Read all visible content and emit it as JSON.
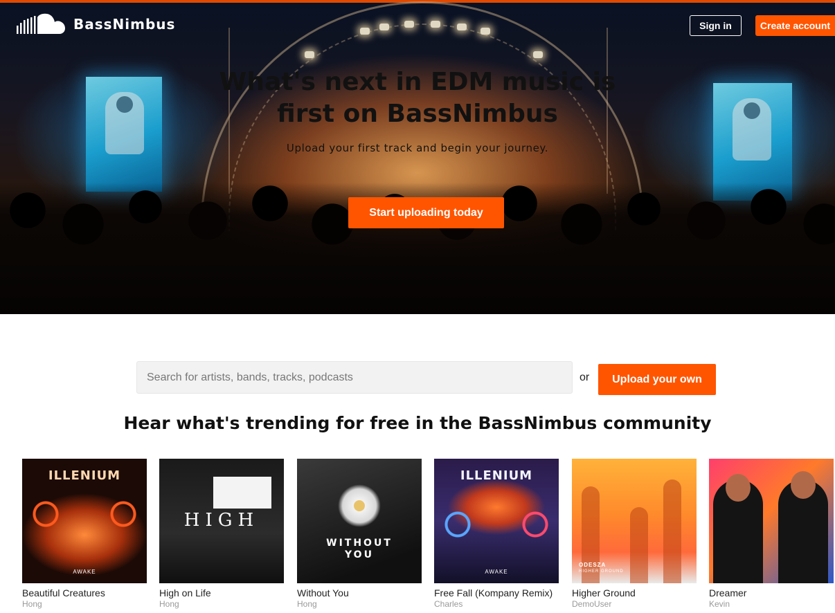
{
  "brand": {
    "name": "BassNimbus"
  },
  "header": {
    "sign_in": "Sign in",
    "create_account": "Create account"
  },
  "hero": {
    "title": "What's next in EDM music is first on BassNimbus",
    "subtitle": "Upload your first track and begin your journey.",
    "cta": "Start uploading today"
  },
  "search": {
    "placeholder": "Search for artists, bands, tracks, podcasts",
    "or_text": "or",
    "upload_button": "Upload your own"
  },
  "trending": {
    "heading": "Hear what's trending for free in the BassNimbus community",
    "tracks": [
      {
        "title": "Beautiful Creatures",
        "artist": "Hong",
        "art_text": "ILLENIUM",
        "art_sub": "AWAKE"
      },
      {
        "title": "High on Life",
        "artist": "Hong",
        "art_text": "HIGH",
        "art_sub": ""
      },
      {
        "title": "Without You",
        "artist": "Hong",
        "art_text": "WITHOUT YOU",
        "art_sub": ""
      },
      {
        "title": "Free Fall (Kompany Remix)",
        "artist": "Charles",
        "art_text": "ILLENIUM",
        "art_sub": "AWAKE"
      },
      {
        "title": "Higher Ground",
        "artist": "DemoUser",
        "art_text": "ODESZA",
        "art_sub": "HIGHER GROUND"
      },
      {
        "title": "Dreamer",
        "artist": "Kevin",
        "art_text": "",
        "art_sub": ""
      }
    ]
  },
  "colors": {
    "accent": "#ff5500",
    "search_bg": "#f2f2f2",
    "artist_text": "#999999"
  }
}
